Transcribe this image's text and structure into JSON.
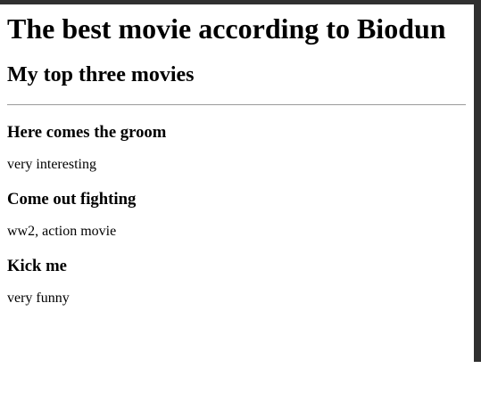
{
  "page": {
    "title": "The best movie according to Biodun",
    "subtitle": "My top three movies"
  },
  "movies": [
    {
      "title": "Here comes the groom",
      "description": "very interesting"
    },
    {
      "title": "Come out fighting",
      "description": "ww2, action movie"
    },
    {
      "title": "Kick me",
      "description": "very funny"
    }
  ]
}
